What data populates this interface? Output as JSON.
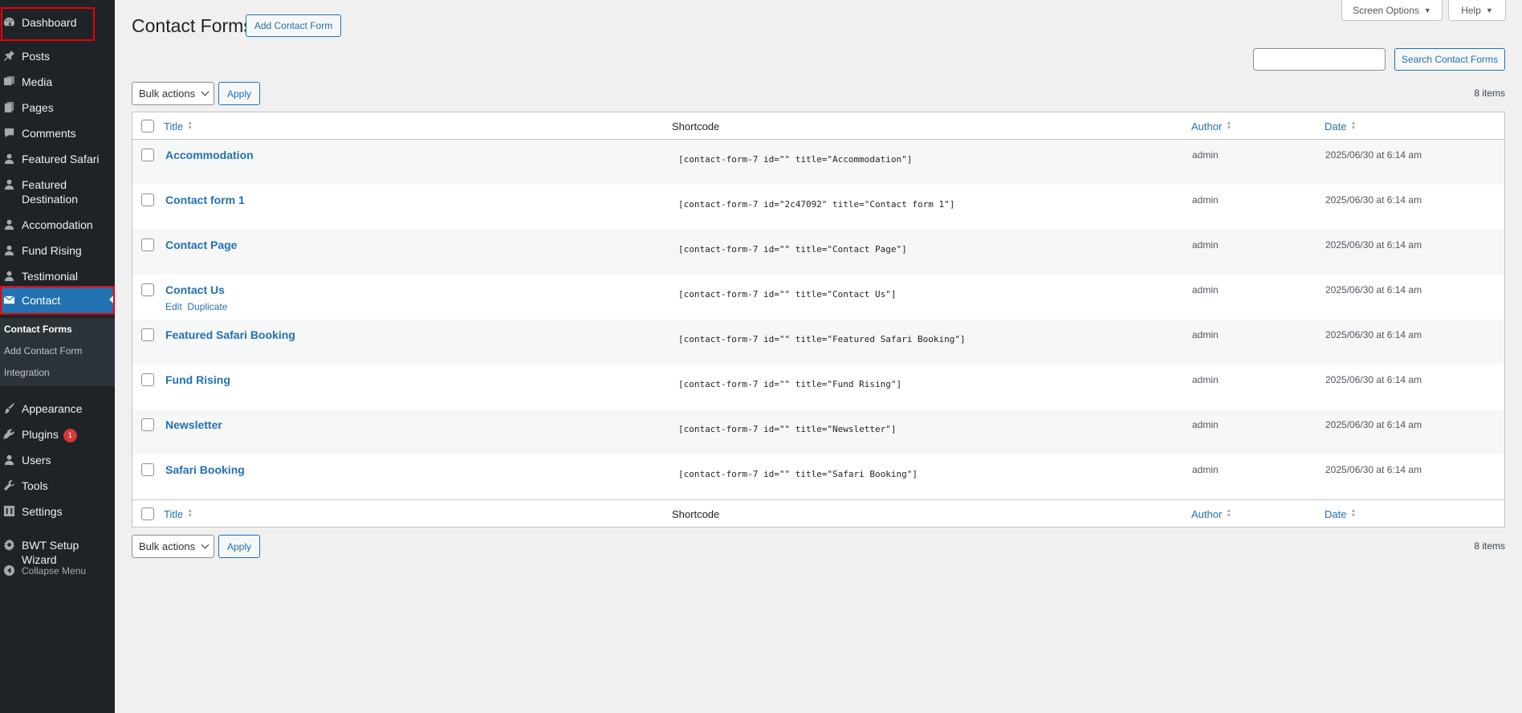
{
  "sidebar": {
    "dashboard": "Dashboard",
    "posts": "Posts",
    "media": "Media",
    "pages": "Pages",
    "comments": "Comments",
    "featured_safari": "Featured Safari",
    "featured_destination_1": "Featured",
    "featured_destination_2": "Destination",
    "accomodation": "Accomodation",
    "fund_rising": "Fund Rising",
    "testimonial": "Testimonial",
    "contact": "Contact",
    "submenu": {
      "contact_forms": "Contact Forms",
      "add_contact_form": "Add Contact Form",
      "integration": "Integration"
    },
    "appearance": "Appearance",
    "plugins": "Plugins",
    "plugins_badge": "1",
    "users": "Users",
    "tools": "Tools",
    "settings": "Settings",
    "bwt_setup_wizard": "BWT Setup Wizard",
    "collapse_menu": "Collapse Menu"
  },
  "header": {
    "title": "Contact Forms",
    "add_button": "Add Contact Form",
    "screen_options": "Screen Options",
    "help": "Help"
  },
  "search": {
    "value": "",
    "button": "Search Contact Forms"
  },
  "toolbar": {
    "bulk_actions": "Bulk actions",
    "apply": "Apply",
    "items_count": "8 items"
  },
  "table": {
    "columns": {
      "title": "Title",
      "shortcode": "Shortcode",
      "author": "Author",
      "date": "Date"
    },
    "rows": [
      {
        "title": "Accommodation",
        "shortcode": "[contact-form-7 id=\"\" title=\"Accommodation\"]",
        "author": "admin",
        "date": "2025/06/30 at 6:14 am"
      },
      {
        "title": "Contact form 1",
        "shortcode": "[contact-form-7 id=\"2c47092\" title=\"Contact form 1\"]",
        "author": "admin",
        "date": "2025/06/30 at 6:14 am"
      },
      {
        "title": "Contact Page",
        "shortcode": "[contact-form-7 id=\"\" title=\"Contact Page\"]",
        "author": "admin",
        "date": "2025/06/30 at 6:14 am"
      },
      {
        "title": "Contact Us",
        "shortcode": "[contact-form-7 id=\"\" title=\"Contact Us\"]",
        "author": "admin",
        "date": "2025/06/30 at 6:14 am"
      },
      {
        "title": "Featured Safari Booking",
        "shortcode": "[contact-form-7 id=\"\" title=\"Featured Safari Booking\"]",
        "author": "admin",
        "date": "2025/06/30 at 6:14 am"
      },
      {
        "title": "Fund Rising",
        "shortcode": "[contact-form-7 id=\"\" title=\"Fund Rising\"]",
        "author": "admin",
        "date": "2025/06/30 at 6:14 am"
      },
      {
        "title": "Newsletter",
        "shortcode": "[contact-form-7 id=\"\" title=\"Newsletter\"]",
        "author": "admin",
        "date": "2025/06/30 at 6:14 am"
      },
      {
        "title": "Safari Booking",
        "shortcode": "[contact-form-7 id=\"\" title=\"Safari Booking\"]",
        "author": "admin",
        "date": "2025/06/30 at 6:14 am"
      }
    ],
    "row_actions": {
      "edit": "Edit",
      "duplicate": "Duplicate"
    }
  },
  "icons": {
    "dashboard": "dashboard-icon",
    "posts": "pin-icon",
    "media": "media-icon",
    "pages": "pages-icon",
    "comments": "comment-icon",
    "contact": "mail-icon",
    "appearance": "brush-icon",
    "plugins": "plugin-icon",
    "users": "user-icon",
    "tools": "wrench-icon",
    "settings": "settings-icon",
    "collapse": "collapse-icon"
  },
  "colors": {
    "sidebar_bg": "#1d2327",
    "accent": "#2271b1",
    "highlight_box": "#e00000",
    "badge": "#d63638"
  }
}
